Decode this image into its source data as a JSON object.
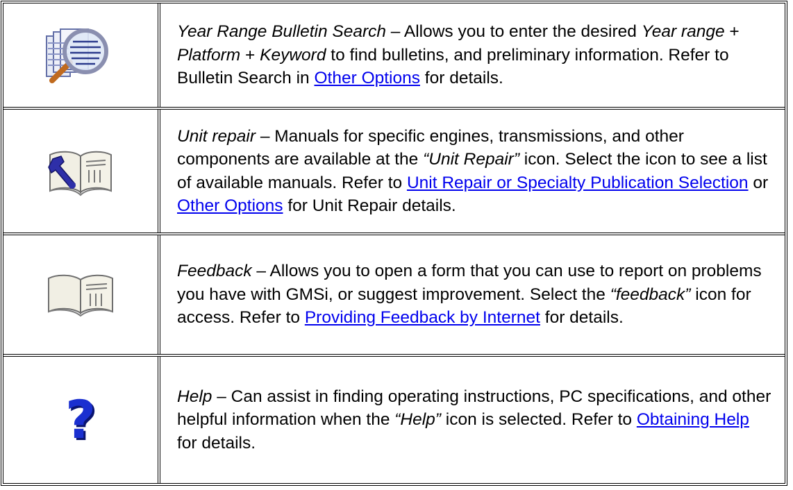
{
  "rows": [
    {
      "icon": "magnifier-over-bulletins-icon",
      "title": "Year Range Bulletin Search",
      "dash": " – Allows you to enter the desired ",
      "em1": "Year range",
      "plus1": " + ",
      "em2": "Platform",
      "plus2": " + ",
      "em3": "Keyword",
      "text2": " to find bulletins, and preliminary information. Refer to Bulletin Search in ",
      "link1": "Other Options",
      "text3": " for details."
    },
    {
      "icon": "wrench-book-icon",
      "title": "Unit repair",
      "text1": " – Manuals for specific engines, transmissions, and other components are available at the ",
      "em1": "“Unit Repair”",
      "text2": " icon. Select the icon to see a list of available manuals. Refer to ",
      "link1": "Unit Repair or Specialty Publication Selection",
      "text3": " or ",
      "link2": "Other Options",
      "text4": " for Unit Repair details."
    },
    {
      "icon": "open-book-icon",
      "title": "Feedback",
      "text1": " – Allows you to open a form that you can use to report on problems you have with GMSi, or suggest improvement. Select the ",
      "em1": "“feedback”",
      "text2": " icon for access. Refer to ",
      "link1": "Providing Feedback by Internet",
      "text3": " for details."
    },
    {
      "icon": "question-mark-icon",
      "title": "Help",
      "text1": " – Can assist in finding operating instructions, PC specifications, and other helpful information when the ",
      "em1": "“Help”",
      "text2": " icon is selected. Refer to ",
      "link1": "Obtaining Help",
      "text3": " for details."
    }
  ],
  "colors": {
    "link": "#0000ee",
    "border": "#000000",
    "question_blue": "#1a2fd0"
  }
}
